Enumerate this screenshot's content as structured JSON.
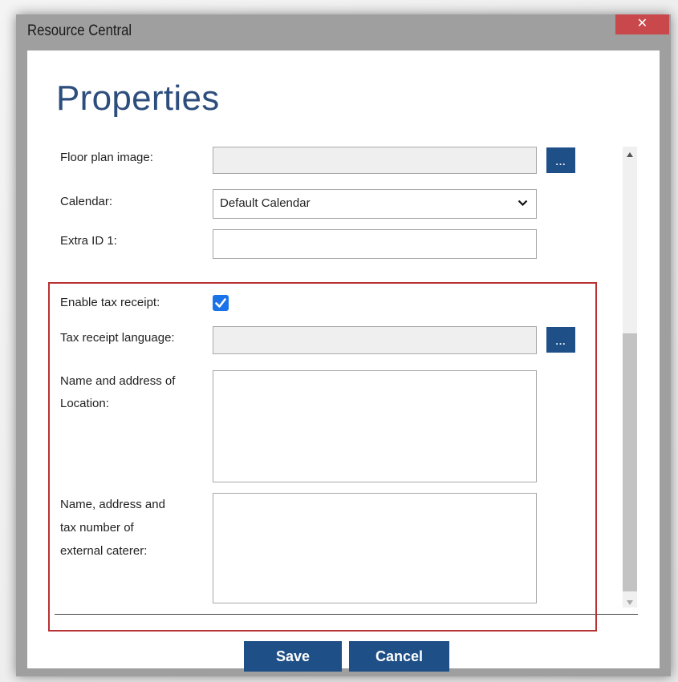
{
  "window": {
    "title": "Resource Central",
    "close_glyph": "✕"
  },
  "page": {
    "heading": "Properties"
  },
  "form": {
    "floor_plan": {
      "label": "Floor plan image:",
      "value": "",
      "browse_label": "..."
    },
    "calendar": {
      "label": "Calendar:",
      "selected": "Default Calendar"
    },
    "extra_id": {
      "label": "Extra ID 1:",
      "value": ""
    },
    "tax_receipt": {
      "label": "Enable tax receipt:",
      "checked": true
    },
    "tax_language": {
      "label": "Tax receipt language:",
      "value": "",
      "browse_label": "..."
    },
    "location": {
      "label_line1": "Name and address of",
      "label_line2": "Location:",
      "value": ""
    },
    "caterer": {
      "label_line1": "Name, address and",
      "label_line2": "tax number of",
      "label_line3": "external caterer:",
      "value": ""
    }
  },
  "buttons": {
    "save": "Save",
    "cancel": "Cancel"
  },
  "colors": {
    "accent": "#1e4f86",
    "heading": "#2d4e7c",
    "highlight": "#b83134",
    "close": "#c9484b",
    "titlebar": "#9f9f9f",
    "checkbox": "#1a73e8"
  },
  "icons": {
    "close": "close-icon",
    "check": "check-icon",
    "chevron": "chevron-down-icon"
  }
}
